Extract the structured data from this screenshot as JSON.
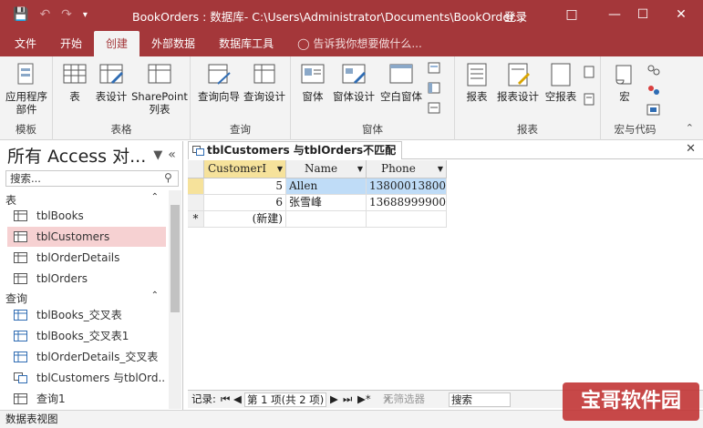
{
  "window": {
    "title": "BookOrders : 数据库- C:\\Users\\Administrator\\Documents\\BookOrder...",
    "login_label": "登录",
    "accent_color": "#a4373a"
  },
  "ribbon_tabs": [
    {
      "label": "文件"
    },
    {
      "label": "开始"
    },
    {
      "label": "创建"
    },
    {
      "label": "外部数据"
    },
    {
      "label": "数据库工具"
    },
    {
      "label": "告诉我你想要做什么..."
    }
  ],
  "ribbon": {
    "groups": {
      "templates": "模板",
      "tables": "表格",
      "queries": "查询",
      "forms": "窗体",
      "reports": "报表",
      "macros": "宏与代码"
    },
    "buttons": {
      "app_parts": "应用程序",
      "app_parts_2": "部件",
      "table": "表",
      "table_design": "表设计",
      "sharepoint": "SharePoint",
      "sharepoint_2": "列表",
      "query_wizard": "查询向导",
      "query_design": "查询设计",
      "form": "窗体",
      "form_design": "窗体设计",
      "blank_form": "空白窗体",
      "report": "报表",
      "report_design": "报表设计",
      "blank_report": "空报表",
      "macro": "宏"
    }
  },
  "nav_pane": {
    "title": "所有 Access 对...",
    "search_placeholder": "搜索...",
    "sections": [
      {
        "label": "表",
        "items": [
          "tblBooks",
          "tblCustomers",
          "tblOrderDetails",
          "tblOrders"
        ]
      },
      {
        "label": "查询",
        "items": [
          "tblBooks_交叉表",
          "tblBooks_交叉表1",
          "tblOrderDetails_交叉表",
          "tblCustomers 与tblOrd...",
          "查询1"
        ]
      }
    ],
    "selected_item": "tblCustomers"
  },
  "document_tab": {
    "label": "tblCustomers 与tblOrders不匹配"
  },
  "datasheet": {
    "columns": [
      "CustomerI",
      "Name",
      "Phone"
    ],
    "rows": [
      {
        "CustomerID": "5",
        "Name": "Allen",
        "Phone": "13800013800"
      },
      {
        "CustomerID": "6",
        "Name": "张雪峰",
        "Phone": "13688999900"
      }
    ],
    "new_row_label": "(新建)",
    "new_row_marker": "*"
  },
  "record_nav": {
    "label": "记录:",
    "position": "第 1 项(共 2 项)",
    "filter_label": "无筛选器",
    "search_label": "搜索"
  },
  "status_bar": {
    "text": "数据表视图"
  },
  "watermark": {
    "text": "宝哥软件园"
  }
}
